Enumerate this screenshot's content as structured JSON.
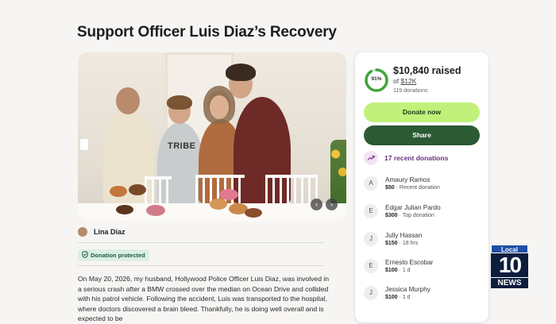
{
  "page": {
    "title": "Support Officer Luis Diaz’s Recovery"
  },
  "hero": {
    "shirt_text": "TRIBE",
    "prev_icon": "chevron-left-icon",
    "next_icon": "chevron-right-icon"
  },
  "organizer": {
    "name": "Lina Diaz"
  },
  "badge": {
    "label": "Donation protected",
    "icon": "shield-check-icon"
  },
  "story": {
    "text": "On May 20, 2026, my husband, Hollywood Police Officer Luis Diaz, was involved in a serious crash after a BMW crossed over the median on Ocean Drive and collided with his patrol vehicle. Following the accident, Luis was transported to the hospital, where doctors discovered a brain bleed. Thankfully, he is doing well overall and is expected to be"
  },
  "fundraiser": {
    "progress_percent": 91,
    "progress_label": "91%",
    "raised": "$10,840 raised",
    "goal_prefix": "of",
    "goal": "$12K",
    "donations_count": "119 donations",
    "donate_label": "Donate now",
    "share_label": "Share",
    "recent_label": "17 recent donations",
    "accent_color": "#c2f17b",
    "share_color": "#2b5a33",
    "ring_color": "#3fa53a"
  },
  "donors": [
    {
      "initial": "A",
      "name": "Amaury Ramos",
      "amount": "$50",
      "meta": "Recent donation"
    },
    {
      "initial": "E",
      "name": "Edgar Julian Pardo",
      "amount": "$300",
      "meta": "Top donation"
    },
    {
      "initial": "J",
      "name": "Jully Hassan",
      "amount": "$150",
      "meta": "18 hrs"
    },
    {
      "initial": "E",
      "name": "Ernesto Escobar",
      "amount": "$100",
      "meta": "1 d"
    },
    {
      "initial": "J",
      "name": "Jessica Murphy",
      "amount": "$100",
      "meta": "1 d"
    }
  ],
  "station": {
    "top": "Local",
    "number": "10",
    "bottom": "NEWS"
  }
}
